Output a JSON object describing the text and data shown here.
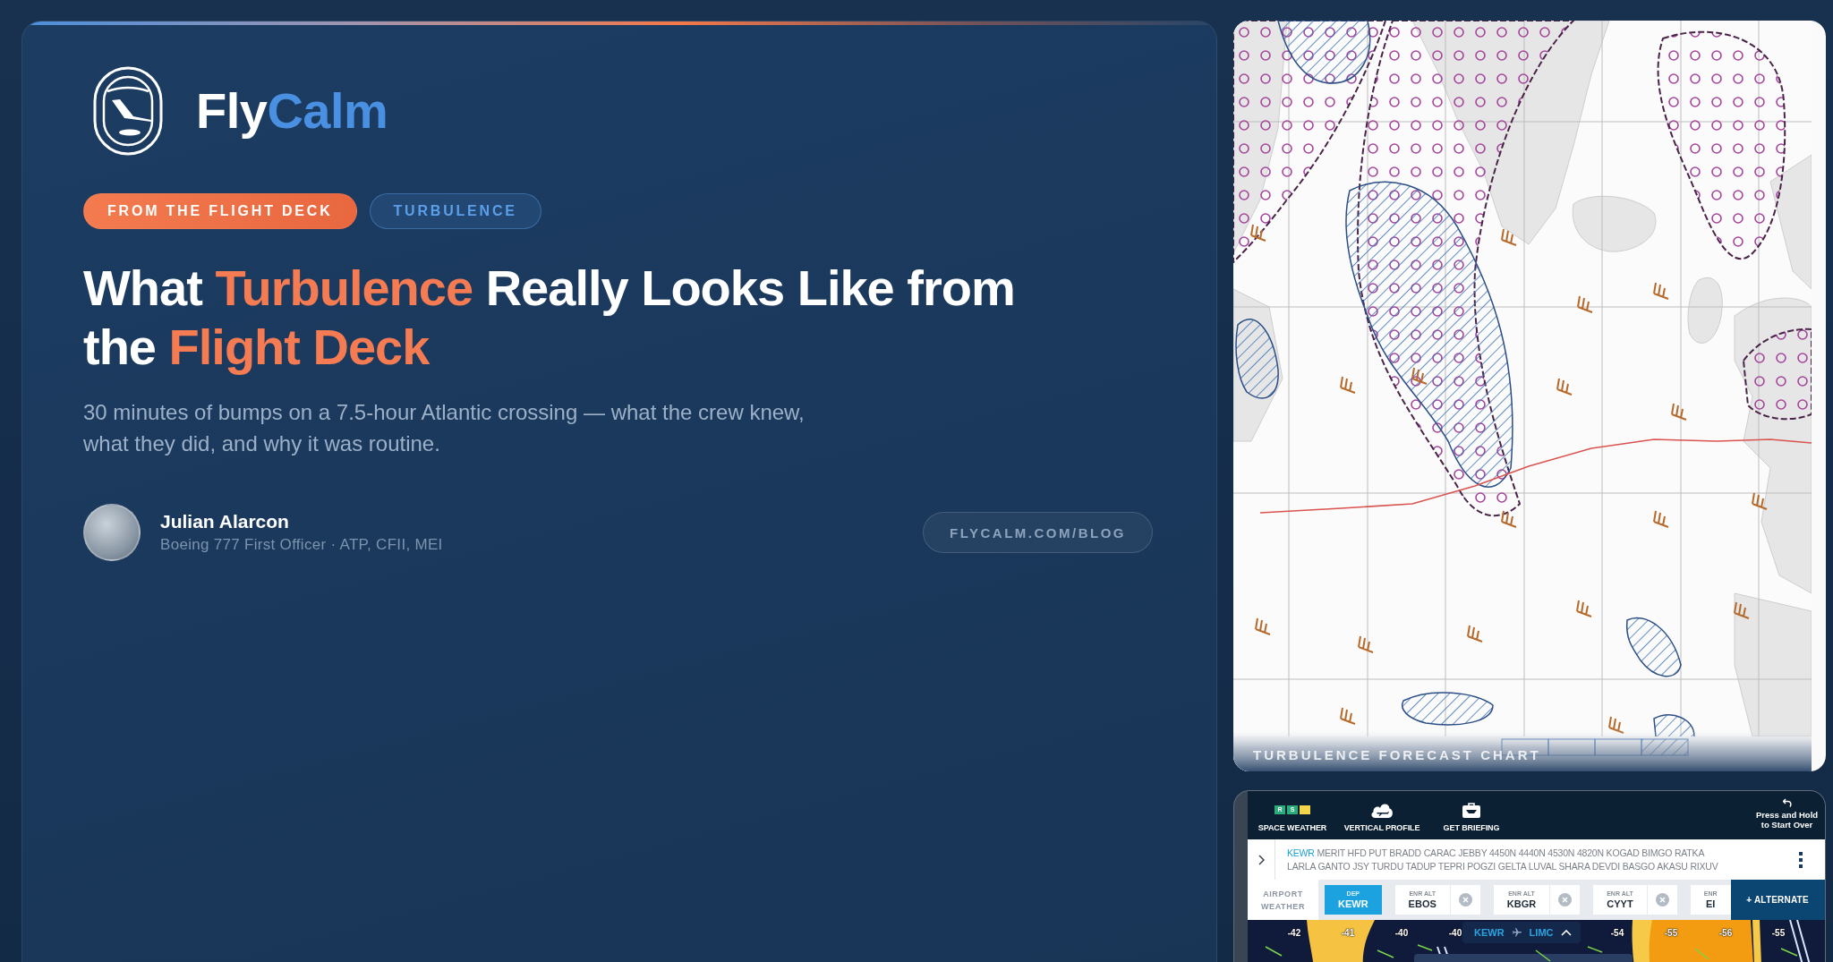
{
  "brand": {
    "name_parts": [
      {
        "text": "Fly",
        "accent": false
      },
      {
        "text": "Calm",
        "accent": true
      }
    ]
  },
  "tags": [
    {
      "label": "FROM THE FLIGHT DECK",
      "kind": "category"
    },
    {
      "label": "TURBULENCE",
      "kind": "topic"
    }
  ],
  "headline": [
    {
      "text": "What ",
      "accent": false
    },
    {
      "text": "Turbulence",
      "accent": true
    },
    {
      "text": " Really Looks Like from the ",
      "accent": false
    },
    {
      "text": "Flight Deck",
      "accent": true
    }
  ],
  "subtitle": "30 minutes of bumps on a 7.5-hour Atlantic crossing — what the crew knew, what they did, and why it was routine.",
  "author": {
    "name": "Julian Alarcon",
    "role": "Boeing 777 First Officer · ATP, CFII, MEI"
  },
  "site_link": {
    "label": "FLYCALM.COM/BLOG"
  },
  "chart_image": {
    "caption": "TURBULENCE FORECAST CHART"
  },
  "app_screenshot": {
    "toolbar": [
      {
        "kind": "space_weather",
        "label": "SPACE WEATHER",
        "scales": [
          {
            "letter": "R",
            "color": "#2bab7a"
          },
          {
            "letter": "S",
            "color": "#2bab7a"
          },
          {
            "color": "#f2d54a"
          }
        ]
      },
      {
        "kind": "vertical_profile",
        "label": "VERTICAL PROFILE"
      },
      {
        "kind": "briefing",
        "label": "GET BRIEFING"
      }
    ],
    "reset_button": {
      "label": "Press and Hold to Start Over"
    },
    "route": {
      "origin": "KEWR",
      "lines": [
        "MERIT HFD PUT BRADD CARAC JEBBY 4450N 4440N 4530N 4820N KOGAD BIMGO RATKA",
        "LARLA GANTO JSY TURDU TADUP TEPRI POGZI GELTA LUVAL SHARA DEVDI BASGO AKASU RIXUV"
      ]
    },
    "airport_weather": {
      "label": "AIRPORT WEATHER",
      "airports": [
        {
          "role": "DEP",
          "code": "KEWR",
          "selected": true,
          "removable": false
        },
        {
          "role": "ENR ALT",
          "code": "EBOS",
          "selected": false,
          "removable": true
        },
        {
          "role": "ENR ALT",
          "code": "KBGR",
          "selected": false,
          "removable": true
        },
        {
          "role": "ENR ALT",
          "code": "CYYT",
          "selected": false,
          "removable": true
        },
        {
          "role": "ENR",
          "code": "EI",
          "selected": false,
          "removable": false
        }
      ],
      "add_button": "+ ALTERNATE"
    },
    "map": {
      "route_pill": {
        "from": "KEWR",
        "to": "LIMC"
      },
      "temperatures": [
        "-42",
        "-41",
        "-40",
        "-40",
        "-54",
        "-55",
        "-56",
        "-55"
      ]
    }
  }
}
